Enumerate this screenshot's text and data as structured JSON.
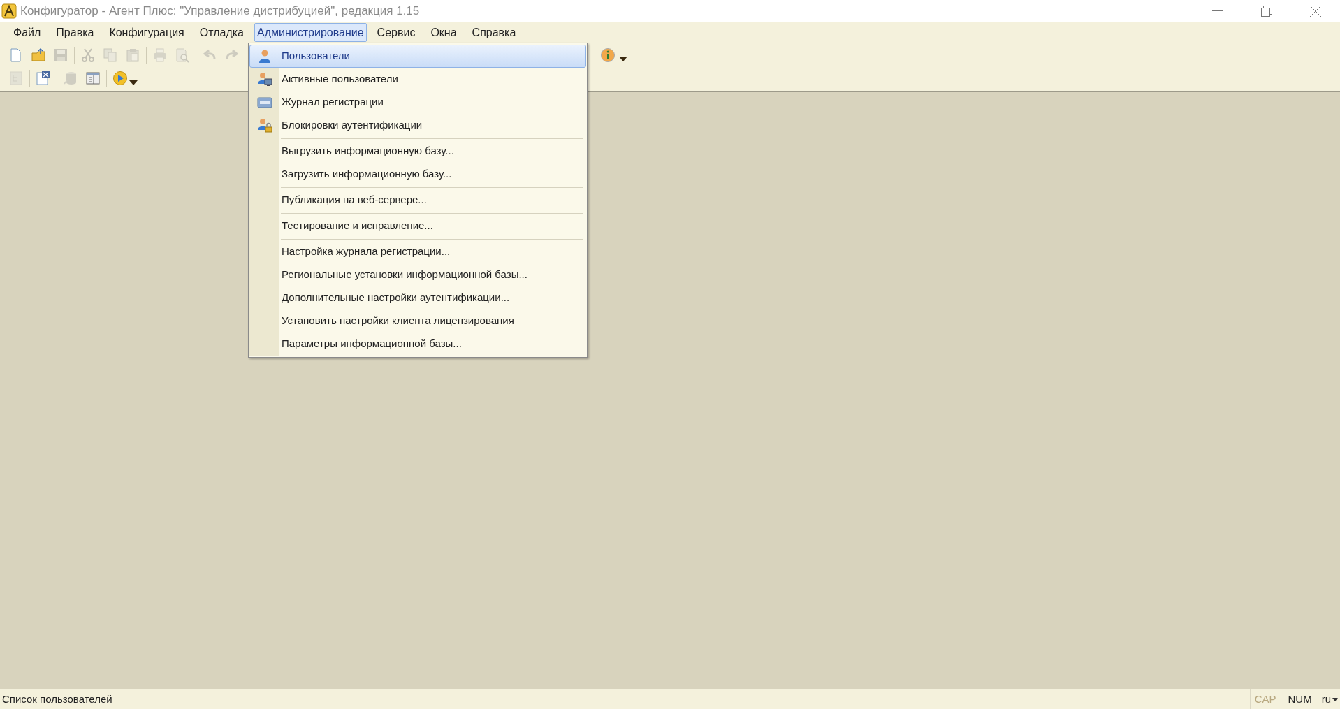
{
  "window": {
    "title": "Конфигуратор - Агент Плюс: \"Управление дистрибуцией\", редакция 1.15"
  },
  "menu_bar": [
    {
      "label": "Файл",
      "selected": false
    },
    {
      "label": "Правка",
      "selected": false
    },
    {
      "label": "Конфигурация",
      "selected": false
    },
    {
      "label": "Отладка",
      "selected": false
    },
    {
      "label": "Администрирование",
      "selected": true
    },
    {
      "label": "Сервис",
      "selected": false
    },
    {
      "label": "Окна",
      "selected": false
    },
    {
      "label": "Справка",
      "selected": false
    }
  ],
  "toolbar_rows": [
    [
      {
        "disabled": false
      },
      {
        "disabled": false
      },
      {
        "disabled": true
      },
      {
        "disabled": true
      },
      {
        "disabled": true
      },
      {
        "disabled": true
      },
      {
        "disabled": true
      },
      {
        "disabled": true
      },
      {
        "disabled": true
      },
      {
        "disabled": true
      },
      {
        "disabled": false
      },
      {
        "disabled": false
      }
    ],
    [
      {
        "disabled": true
      },
      {
        "disabled": false
      },
      {
        "disabled": true
      },
      {
        "disabled": false
      },
      {
        "disabled": false
      }
    ]
  ],
  "dropdown": {
    "sections": [
      [
        {
          "label": "Пользователи",
          "selected": true
        },
        {
          "label": "Активные пользователи",
          "selected": false
        },
        {
          "label": "Журнал регистрации",
          "selected": false
        },
        {
          "label": "Блокировки аутентификации",
          "selected": false
        }
      ],
      [
        {
          "label": "Выгрузить информационную базу...",
          "selected": false
        },
        {
          "label": "Загрузить информационную базу...",
          "selected": false
        }
      ],
      [
        {
          "label": "Публикация на веб-сервере...",
          "selected": false
        }
      ],
      [
        {
          "label": "Тестирование и исправление...",
          "selected": false
        }
      ],
      [
        {
          "label": "Настройка журнала регистрации...",
          "selected": false
        },
        {
          "label": "Региональные установки информационной базы...",
          "selected": false
        },
        {
          "label": "Дополнительные настройки аутентификации...",
          "selected": false
        },
        {
          "label": "Установить настройки клиента лицензирования",
          "selected": false
        },
        {
          "label": "Параметры информационной базы...",
          "selected": false
        }
      ]
    ]
  },
  "status_bar": {
    "text": "Список пользователей",
    "indicators": [
      {
        "label": "CAP",
        "on": false
      },
      {
        "label": "NUM",
        "on": true
      }
    ],
    "language": "ru"
  }
}
